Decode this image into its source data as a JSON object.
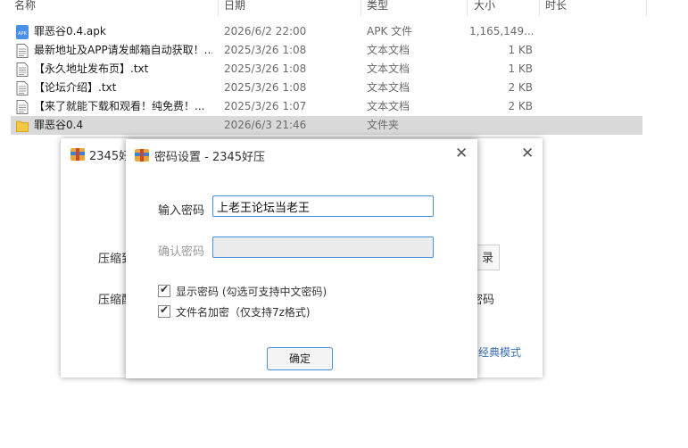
{
  "explorer": {
    "columns": [
      "名称",
      "日期",
      "类型",
      "大小",
      "时长"
    ],
    "rows": [
      {
        "name": "罪恶谷0.4.apk",
        "date": "2026/6/2 22:00",
        "type": "APK 文件",
        "size": "1,165,149...",
        "icon": "apk-file-icon",
        "selected": false
      },
      {
        "name": "最新地址及APP请发邮箱自动获取！...",
        "date": "2025/3/26 1:08",
        "type": "文本文档",
        "size": "1 KB",
        "icon": "text-file-icon",
        "selected": false
      },
      {
        "name": "【永久地址发布页】.txt",
        "date": "2025/3/26 1:08",
        "type": "文本文档",
        "size": "1 KB",
        "icon": "text-file-icon",
        "selected": false
      },
      {
        "name": "【论坛介绍】.txt",
        "date": "2025/3/26 1:08",
        "type": "文本文档",
        "size": "2 KB",
        "icon": "text-file-icon",
        "selected": false
      },
      {
        "name": "【来了就能下载和观看！纯免费！...",
        "date": "2025/3/26 1:07",
        "type": "文本文档",
        "size": "2 KB",
        "icon": "text-file-icon",
        "selected": false
      },
      {
        "name": "罪恶谷0.4",
        "date": "2026/6/3 21:46",
        "type": "文件夹",
        "size": "",
        "icon": "folder-icon",
        "selected": true
      }
    ]
  },
  "bg_window": {
    "title": "2345好",
    "label1": "压缩到",
    "label2": "压缩配",
    "browse_label": "录",
    "password_tail": "密码",
    "classic_mode": "经典模式"
  },
  "dialog": {
    "title": "密码设置 - 2345好压",
    "password_label": "输入密码",
    "password_value": "上老王论坛当老王",
    "confirm_label": "确认密码",
    "confirm_value": "",
    "show_password": {
      "label": "显示密码 (勾选可支持中文密码)",
      "checked": true
    },
    "encrypt_filenames": {
      "label": "文件名加密（仅支持7z格式)",
      "checked": true
    },
    "ok_label": "确定"
  },
  "colors": {
    "accent": "#4a8fd9",
    "selection": "#d9d9d9",
    "link": "#3b6fb6"
  }
}
